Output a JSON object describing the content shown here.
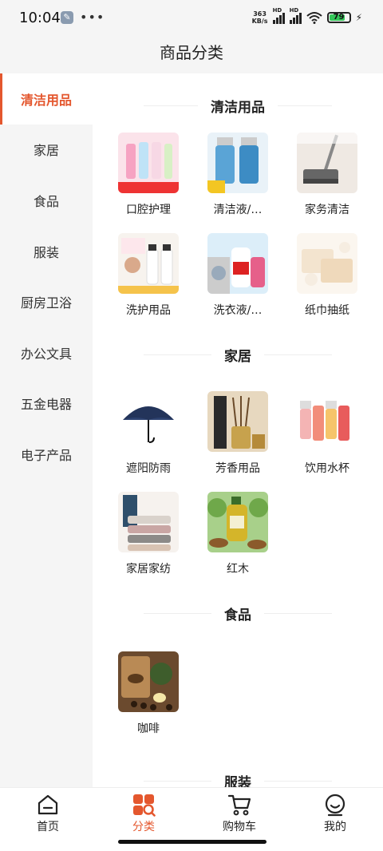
{
  "status_bar": {
    "time": "10:04",
    "net_speed_top": "363",
    "net_speed_bottom": "KB/s",
    "signal1_tag": "HD",
    "signal2_tag": "HD",
    "battery": "79"
  },
  "header": {
    "title": "商品分类"
  },
  "sidebar": {
    "items": [
      {
        "label": "清洁用品",
        "active": true
      },
      {
        "label": "家居"
      },
      {
        "label": "食品"
      },
      {
        "label": "服装"
      },
      {
        "label": "厨房卫浴"
      },
      {
        "label": "办公文具"
      },
      {
        "label": "五金电器"
      },
      {
        "label": "电子产品"
      }
    ]
  },
  "sections": [
    {
      "title": "清洁用品",
      "items": [
        "口腔护理",
        "清洁液/…",
        "家务清洁",
        "洗护用品",
        "洗衣液/…",
        "纸巾抽纸"
      ]
    },
    {
      "title": "家居",
      "items": [
        "遮阳防雨",
        "芳香用品",
        "饮用水杯",
        "家居家纺",
        "红木"
      ]
    },
    {
      "title": "食品",
      "items": [
        "咖啡"
      ]
    },
    {
      "title": "服装",
      "items": []
    }
  ],
  "tabbar": {
    "tabs": [
      {
        "label": "首页",
        "icon": "home-icon"
      },
      {
        "label": "分类",
        "icon": "category-icon",
        "active": true
      },
      {
        "label": "购物车",
        "icon": "cart-icon"
      },
      {
        "label": "我的",
        "icon": "profile-icon"
      }
    ]
  },
  "colors": {
    "accent": "#e4572e",
    "sidebar_bg": "#f5f5f5"
  }
}
